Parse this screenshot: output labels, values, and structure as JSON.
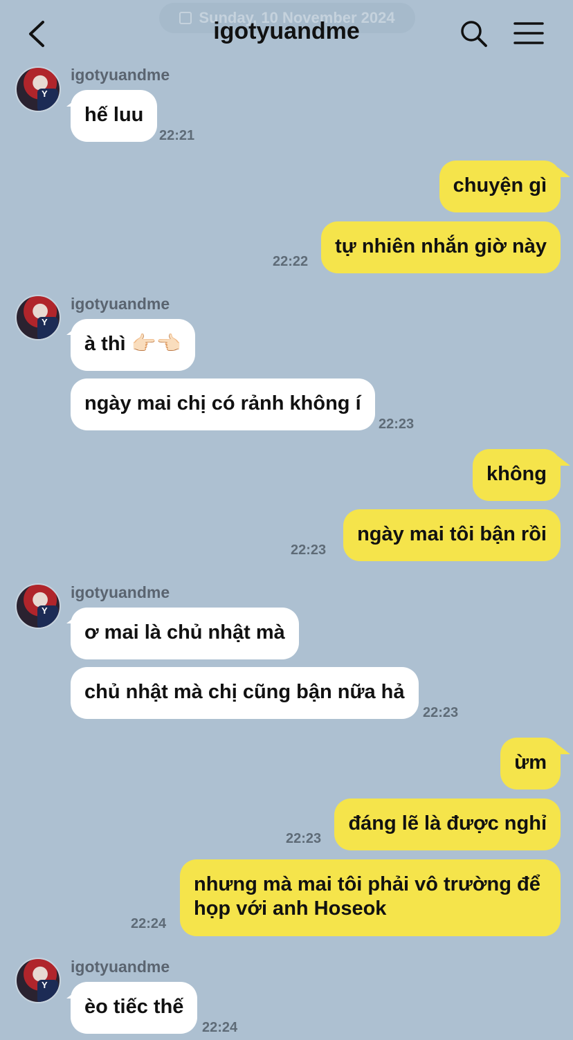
{
  "header": {
    "date": "Sunday, 10 November 2024",
    "title": "igotyuandme"
  },
  "messages": [
    {
      "from": "in",
      "sender": "igotyuandme",
      "texts": [
        "hế luu"
      ],
      "time": "22:21"
    },
    {
      "from": "out",
      "texts": [
        "chuyện gì",
        "tự nhiên nhắn giờ này"
      ],
      "time": "22:22"
    },
    {
      "from": "in",
      "sender": "igotyuandme",
      "texts": [
        "à thì 👉🏻👈🏻",
        "ngày mai chị có rảnh không í"
      ],
      "time": "22:23"
    },
    {
      "from": "out",
      "texts": [
        "không",
        "ngày mai tôi bận rồi"
      ],
      "time": "22:23"
    },
    {
      "from": "in",
      "sender": "igotyuandme",
      "texts": [
        "ơ mai là chủ nhật mà",
        "chủ nhật mà chị cũng bận nữa hả"
      ],
      "time": "22:23"
    },
    {
      "from": "out",
      "texts": [
        "ừm",
        "đáng lẽ là được nghỉ"
      ],
      "time": "22:23"
    },
    {
      "from": "out",
      "texts": [
        "nhưng mà mai tôi phải vô trường để họp với anh Hoseok"
      ],
      "time": "22:24"
    },
    {
      "from": "in",
      "sender": "igotyuandme",
      "texts": [
        "èo tiếc thế"
      ],
      "time": "22:24"
    }
  ]
}
